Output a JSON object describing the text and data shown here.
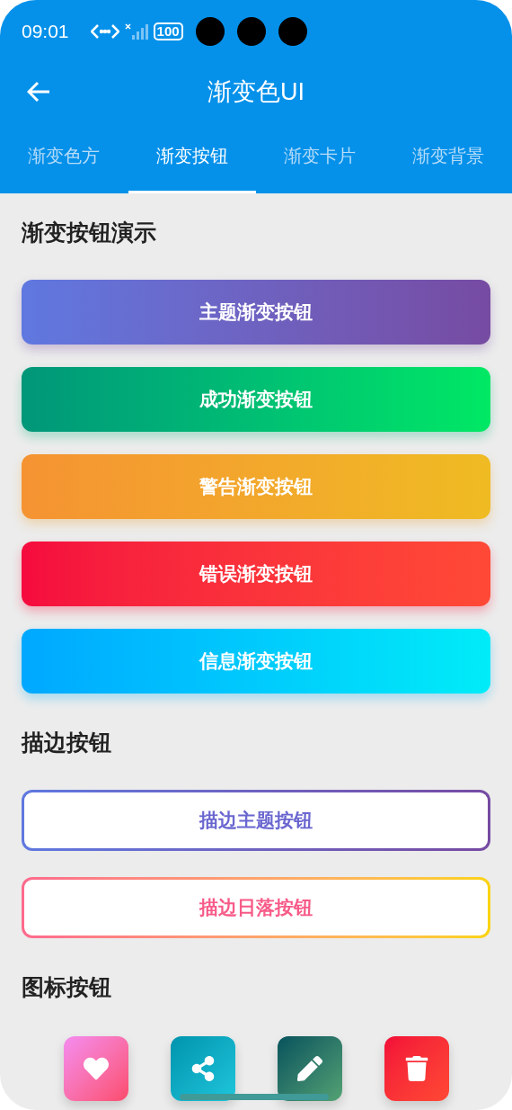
{
  "status_bar": {
    "time": "09:01",
    "battery": "100"
  },
  "app_bar": {
    "title": "渐变色UI"
  },
  "tabs": [
    {
      "label": "渐变色方",
      "selected": false
    },
    {
      "label": "渐变按钮",
      "selected": true
    },
    {
      "label": "渐变卡片",
      "selected": false
    },
    {
      "label": "渐变背景",
      "selected": false
    }
  ],
  "sections": [
    {
      "title": "渐变按钮演示",
      "kind": "filled",
      "buttons": [
        {
          "label": "主题渐变按钮",
          "kind": "theme"
        },
        {
          "label": "成功渐变按钮",
          "kind": "success"
        },
        {
          "label": "警告渐变按钮",
          "kind": "warning"
        },
        {
          "label": "错误渐变按钮",
          "kind": "error"
        },
        {
          "label": "信息渐变按钮",
          "kind": "info"
        }
      ]
    },
    {
      "title": "描边按钮",
      "kind": "outline",
      "buttons": [
        {
          "label": "描边主题按钮",
          "kind": "theme"
        },
        {
          "label": "描边日落按钮",
          "kind": "sunset"
        }
      ]
    },
    {
      "title": "图标按钮",
      "kind": "icon",
      "buttons": [
        {
          "kind": "heart"
        },
        {
          "kind": "share"
        },
        {
          "kind": "edit"
        },
        {
          "kind": "delete"
        }
      ]
    }
  ]
}
